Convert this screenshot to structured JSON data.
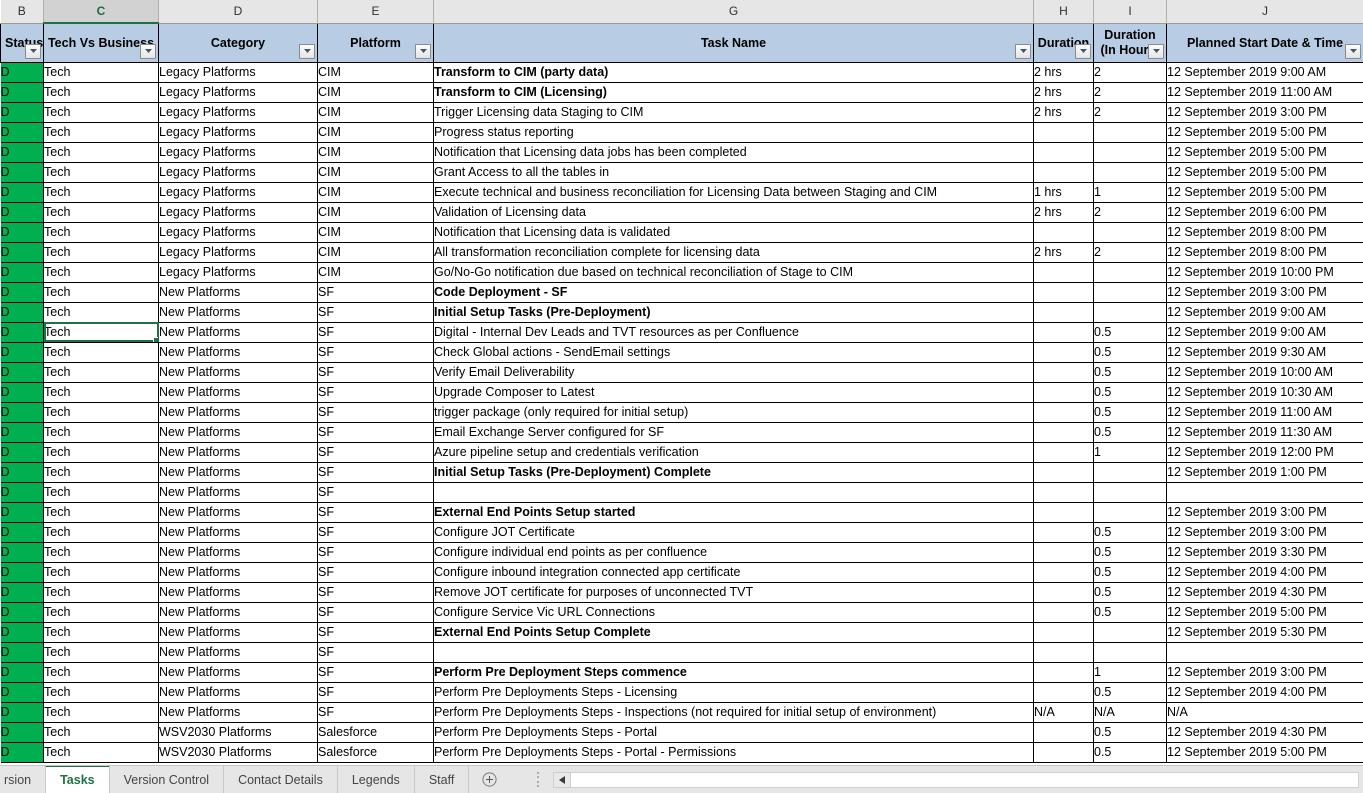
{
  "columns": {
    "letters": [
      "B",
      "C",
      "D",
      "E",
      "G",
      "H",
      "I",
      "J"
    ],
    "selected_letter": "C"
  },
  "headers": [
    {
      "id": "status",
      "label": "Status",
      "filter": true
    },
    {
      "id": "tech_vs_business",
      "label": "Tech Vs Business",
      "filter": true
    },
    {
      "id": "category",
      "label": "Category",
      "filter": true
    },
    {
      "id": "platform",
      "label": "Platform",
      "filter": true
    },
    {
      "id": "task_name",
      "label": "Task Name",
      "filter": true
    },
    {
      "id": "duration",
      "label": "Duration",
      "filter": true
    },
    {
      "id": "duration_hours",
      "label": "Duration (In Hours)",
      "filter": true
    },
    {
      "id": "planned_start",
      "label": "Planned Start Date & Time",
      "filter": true
    }
  ],
  "rows": [
    {
      "status": "D",
      "tech": "Tech",
      "category": "Legacy Platforms",
      "platform": "CIM",
      "task": "Transform to CIM (party data)",
      "bold": true,
      "indent": 0,
      "duration": "2 hrs",
      "hours": "2",
      "start": "12 September 2019 9:00 AM"
    },
    {
      "status": "D",
      "tech": "Tech",
      "category": "Legacy Platforms",
      "platform": "CIM",
      "task": "Transform to CIM (Licensing)",
      "bold": true,
      "indent": 0,
      "duration": "2 hrs",
      "hours": "2",
      "start": "12 September 2019 11:00 AM"
    },
    {
      "status": "D",
      "tech": "Tech",
      "category": "Legacy Platforms",
      "platform": "CIM",
      "task": "Trigger Licensing data Staging to CIM",
      "bold": false,
      "indent": 2,
      "duration": "2 hrs",
      "hours": "2",
      "start": "12 September 2019 3:00 PM"
    },
    {
      "status": "D",
      "tech": "Tech",
      "category": "Legacy Platforms",
      "platform": "CIM",
      "task": "Progress status reporting",
      "bold": false,
      "indent": 2,
      "duration": "",
      "hours": "",
      "start": "12 September 2019 5:00 PM"
    },
    {
      "status": "D",
      "tech": "Tech",
      "category": "Legacy Platforms",
      "platform": "CIM",
      "task": "Notification that Licensing data jobs has been completed",
      "bold": false,
      "indent": 2,
      "duration": "",
      "hours": "",
      "start": "12 September 2019 5:00 PM"
    },
    {
      "status": "D",
      "tech": "Tech",
      "category": "Legacy Platforms",
      "platform": "CIM",
      "task": "Grant Access to all the tables in",
      "bold": false,
      "indent": 2,
      "duration": "",
      "hours": "",
      "start": "12 September 2019 5:00 PM"
    },
    {
      "status": "D",
      "tech": "Tech",
      "category": "Legacy Platforms",
      "platform": "CIM",
      "task": "Execute technical and business reconciliation for Licensing Data between Staging and CIM",
      "bold": false,
      "indent": 2,
      "duration": "1 hrs",
      "hours": "1",
      "start": "12 September 2019 5:00 PM"
    },
    {
      "status": "D",
      "tech": "Tech",
      "category": "Legacy Platforms",
      "platform": "CIM",
      "task": "Validation of Licensing data",
      "bold": false,
      "indent": 2,
      "duration": "2 hrs",
      "hours": "2",
      "start": "12 September 2019 6:00 PM"
    },
    {
      "status": "D",
      "tech": "Tech",
      "category": "Legacy Platforms",
      "platform": "CIM",
      "task": "Notification that Licensing data is validated",
      "bold": false,
      "indent": 2,
      "duration": "",
      "hours": "",
      "start": "12 September 2019 8:00 PM"
    },
    {
      "status": "D",
      "tech": "Tech",
      "category": "Legacy Platforms",
      "platform": "CIM",
      "task": "All transformation reconciliation complete for licensing data",
      "bold": false,
      "indent": 2,
      "duration": "2 hrs",
      "hours": "2",
      "start": "12 September 2019 8:00 PM"
    },
    {
      "status": "D",
      "tech": "Tech",
      "category": "Legacy Platforms",
      "platform": "CIM",
      "task": "Go/No-Go notification due based on technical reconciliation of Stage to CIM",
      "bold": false,
      "indent": 2,
      "duration": "",
      "hours": "",
      "start": "12 September 2019 10:00 PM"
    },
    {
      "status": "D",
      "tech": "Tech",
      "category": "New Platforms",
      "platform": "SF",
      "task": "Code Deployment - SF",
      "bold": true,
      "indent": 0,
      "duration": "",
      "hours": "",
      "start": "12 September 2019 3:00 PM"
    },
    {
      "status": "D",
      "tech": "Tech",
      "category": "New Platforms",
      "platform": "SF",
      "task": "Initial Setup Tasks (Pre-Deployment)",
      "bold": true,
      "indent": 0,
      "duration": "",
      "hours": "",
      "start": "12 September 2019 9:00 AM"
    },
    {
      "status": "D",
      "tech": "Tech",
      "category": "New Platforms",
      "platform": "SF",
      "task": "Digital - Internal Dev Leads and TVT resources as per Confluence",
      "bold": false,
      "indent": 0,
      "duration": "",
      "hours": "0.5",
      "start": "12 September 2019 9:00 AM"
    },
    {
      "status": "D",
      "tech": "Tech",
      "category": "New Platforms",
      "platform": "SF",
      "task": "Check Global actions - SendEmail settings",
      "bold": false,
      "indent": 0,
      "duration": "",
      "hours": "0.5",
      "start": "12 September 2019 9:30 AM"
    },
    {
      "status": "D",
      "tech": "Tech",
      "category": "New Platforms",
      "platform": "SF",
      "task": "Verify Email Deliverability",
      "bold": false,
      "indent": 0,
      "duration": "",
      "hours": "0.5",
      "start": "12 September 2019 10:00 AM"
    },
    {
      "status": "D",
      "tech": "Tech",
      "category": "New Platforms",
      "platform": "SF",
      "task": "Upgrade Composer to Latest",
      "bold": false,
      "indent": 0,
      "duration": "",
      "hours": "0.5",
      "start": "12 September 2019 10:30 AM"
    },
    {
      "status": "D",
      "tech": "Tech",
      "category": "New Platforms",
      "platform": "SF",
      "task": "trigger package (only required for initial setup)",
      "bold": false,
      "indent": 0,
      "duration": "",
      "hours": "0.5",
      "start": "12 September 2019 11:00 AM"
    },
    {
      "status": "D",
      "tech": "Tech",
      "category": "New Platforms",
      "platform": "SF",
      "task": "Email Exchange Server configured for SF",
      "bold": false,
      "indent": 0,
      "duration": "",
      "hours": "0.5",
      "start": "12 September 2019 11:30 AM"
    },
    {
      "status": "D",
      "tech": "Tech",
      "category": "New Platforms",
      "platform": "SF",
      "task": "Azure pipeline setup and credentials verification",
      "bold": false,
      "indent": 0,
      "duration": "",
      "hours": "1",
      "start": "12 September 2019 12:00 PM"
    },
    {
      "status": "D",
      "tech": "Tech",
      "category": "New Platforms",
      "platform": "SF",
      "task": "Initial Setup Tasks (Pre-Deployment) Complete",
      "bold": true,
      "indent": 0,
      "duration": "",
      "hours": "",
      "start": "12 September 2019 1:00 PM"
    },
    {
      "status": "D",
      "tech": "Tech",
      "category": "New Platforms",
      "platform": "SF",
      "task": "",
      "bold": false,
      "indent": 0,
      "duration": "",
      "hours": "",
      "start": ""
    },
    {
      "status": "D",
      "tech": "Tech",
      "category": "New Platforms",
      "platform": "SF",
      "task": "External End Points Setup started",
      "bold": true,
      "indent": 0,
      "duration": "",
      "hours": "",
      "start": "12 September 2019 3:00 PM"
    },
    {
      "status": "D",
      "tech": "Tech",
      "category": "New Platforms",
      "platform": "SF",
      "task": "Configure JOT Certificate",
      "bold": false,
      "indent": 2,
      "duration": "",
      "hours": "0.5",
      "start": "12 September 2019 3:00 PM"
    },
    {
      "status": "D",
      "tech": "Tech",
      "category": "New Platforms",
      "platform": "SF",
      "task": "Configure individual end points as per confluence",
      "bold": false,
      "indent": 1,
      "duration": "",
      "hours": "0.5",
      "start": "12 September 2019 3:30 PM"
    },
    {
      "status": "D",
      "tech": "Tech",
      "category": "New Platforms",
      "platform": "SF",
      "task": "Configure inbound integration connected app certificate",
      "bold": false,
      "indent": 1,
      "duration": "",
      "hours": "0.5",
      "start": "12 September 2019 4:00 PM"
    },
    {
      "status": "D",
      "tech": "Tech",
      "category": "New Platforms",
      "platform": "SF",
      "task": "Remove JOT certificate for purposes of unconnected TVT",
      "bold": false,
      "indent": 1,
      "duration": "",
      "hours": "0.5",
      "start": "12 September 2019 4:30 PM"
    },
    {
      "status": "D",
      "tech": "Tech",
      "category": "New Platforms",
      "platform": "SF",
      "task": "Configure Service Vic URL Connections",
      "bold": false,
      "indent": 2,
      "duration": "",
      "hours": "0.5",
      "start": "12 September 2019 5:00 PM"
    },
    {
      "status": "D",
      "tech": "Tech",
      "category": "New Platforms",
      "platform": "SF",
      "task": "External End Points Setup Complete",
      "bold": true,
      "indent": 0,
      "duration": "",
      "hours": "",
      "start": "12 September 2019 5:30 PM"
    },
    {
      "status": "D",
      "tech": "Tech",
      "category": "New Platforms",
      "platform": "SF",
      "task": "",
      "bold": false,
      "indent": 0,
      "duration": "",
      "hours": "",
      "start": ""
    },
    {
      "status": "D",
      "tech": "Tech",
      "category": "New Platforms",
      "platform": "SF",
      "task": "Perform Pre Deployment Steps commence",
      "bold": true,
      "indent": 0,
      "duration": "",
      "hours": "1",
      "start": "12 September 2019 3:00 PM"
    },
    {
      "status": "D",
      "tech": "Tech",
      "category": "New Platforms",
      "platform": "SF",
      "task": "Perform Pre Deployments Steps - Licensing",
      "bold": false,
      "indent": 0,
      "duration": "",
      "hours": "0.5",
      "start": "12 September 2019 4:00 PM"
    },
    {
      "status": "D",
      "tech": "Tech",
      "category": "New Platforms",
      "platform": "SF",
      "task": "Perform Pre Deployments Steps - Inspections (not required for initial setup of environment)",
      "bold": false,
      "indent": 0,
      "duration": "N/A",
      "hours": "N/A",
      "start": "N/A"
    },
    {
      "status": "D",
      "tech": "Tech",
      "category": "WSV2030 Platforms",
      "platform": "Salesforce",
      "task": "Perform Pre Deployments Steps - Portal",
      "bold": false,
      "indent": 0,
      "duration": "",
      "hours": "0.5",
      "start": "12 September 2019 4:30 PM"
    },
    {
      "status": "D",
      "tech": "Tech",
      "category": "WSV2030 Platforms",
      "platform": "Salesforce",
      "task": "Perform Pre Deployments Steps - Portal - Permissions",
      "bold": false,
      "indent": 0,
      "duration": "",
      "hours": "0.5",
      "start": "12 September 2019 5:00 PM"
    }
  ],
  "selection": {
    "column": "C",
    "row_index": 13
  },
  "sheet_tabs": {
    "partial_left": "rsion",
    "tabs": [
      "Tasks",
      "Version Control",
      "Contact Details",
      "Legends",
      "Staff"
    ],
    "active": "Tasks",
    "add_sheet_label": "+"
  },
  "colors": {
    "status_green": "#00B050",
    "header_blue": "#B8CCE4",
    "selection_green": "#1E7145",
    "colhead_gray": "#E6E6E6"
  }
}
